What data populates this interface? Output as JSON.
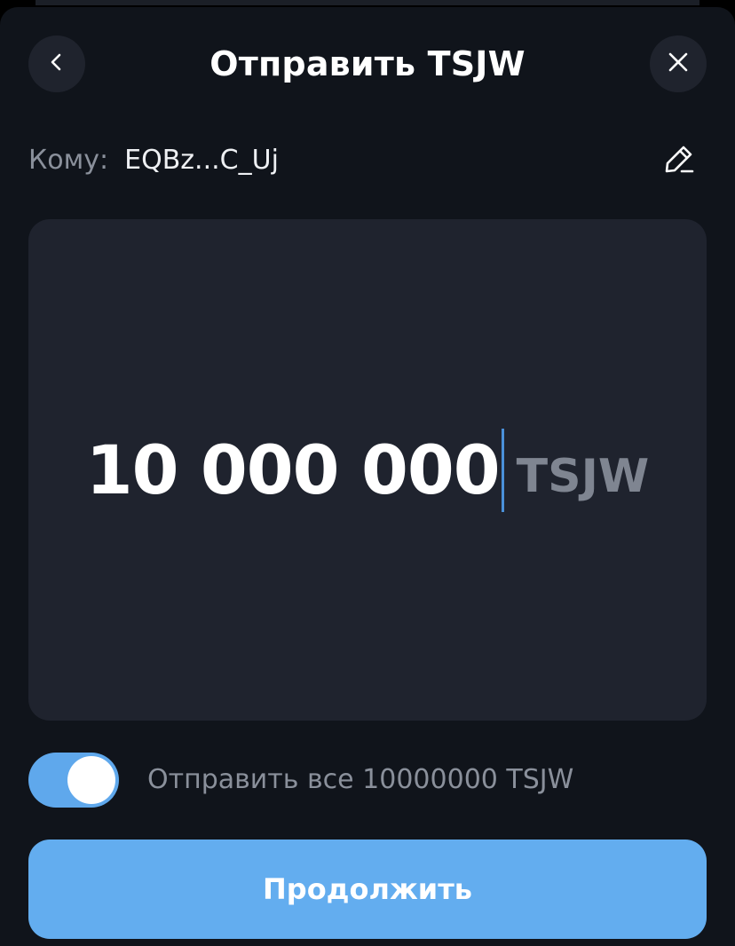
{
  "header": {
    "title": "Отправить TSJW",
    "back_icon": "chevron-left-icon",
    "close_icon": "close-icon"
  },
  "recipient": {
    "label": "Кому:",
    "address": "EQBz...C_Uj",
    "edit_icon": "pencil-icon"
  },
  "amount": {
    "value": "10 000 000",
    "currency": "TSJW"
  },
  "send_all": {
    "enabled": true,
    "label": "Отправить все 10000000 TSJW"
  },
  "continue_button": {
    "label": "Продолжить"
  },
  "colors": {
    "background": "#10141b",
    "card": "#1f232e",
    "accent": "#63adef",
    "toggle_on": "#5fa8ec",
    "muted_text": "#8a909b",
    "caret": "#4a90d9"
  }
}
